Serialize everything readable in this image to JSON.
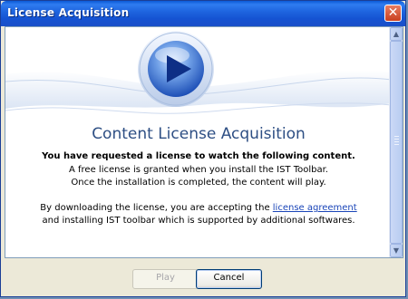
{
  "window": {
    "title": "License Acquisition",
    "close_glyph": "✕"
  },
  "content": {
    "heading": "Content License Acquisition",
    "line_bold": "You have requested a license to watch the following content.",
    "line_2": "A free license is granted when you install the IST Toolbar.",
    "line_3": "Once the installation is completed, the content will play.",
    "line_4_prefix": "By downloading the license, you are accepting the ",
    "line_4_link": "license agreement",
    "line_5": "and installing IST toolbar which is supported by additional softwares."
  },
  "scrollbar": {
    "up_glyph": "▲",
    "down_glyph": "▼"
  },
  "buttons": {
    "play_label": "Play",
    "play_enabled": false,
    "cancel_label": "Cancel"
  },
  "colors": {
    "titlebar": "#1f66e0",
    "heading": "#2e4f84",
    "link": "#1a45b8",
    "wave": "#e2eaf6"
  },
  "icons": {
    "hero": "play-orb-icon",
    "close": "close-icon"
  }
}
